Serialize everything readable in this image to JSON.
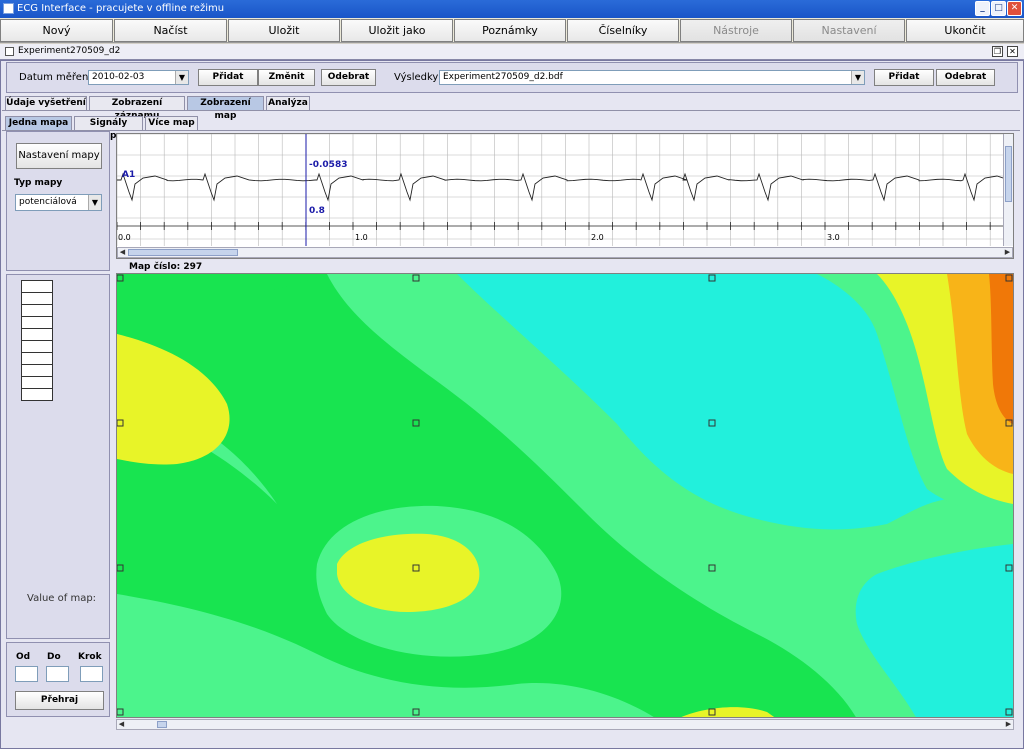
{
  "window": {
    "title": "ECG Interface - pracujete v offline režimu"
  },
  "toolbar": {
    "new": "Nový",
    "load": "Načíst",
    "save": "Uložit",
    "save_as": "Uložit jako",
    "notes": "Poznámky",
    "codebooks": "Číselníky",
    "tools": "Nástroje",
    "settings": "Nastavení",
    "quit": "Ukončit"
  },
  "frame": {
    "title": "Experiment270509_d2"
  },
  "datum": {
    "label": "Datum měření",
    "value": "2010-02-03",
    "add": "Přidat",
    "change": "Změnit",
    "remove": "Odebrat",
    "results_label": "Výsledky",
    "results_value": "Experiment270509_d2.bdf",
    "results_add": "Přidat",
    "results_remove": "Odebrat"
  },
  "tabs": [
    "Údaje vyšetření",
    "Zobrazení záznamu",
    "Zobrazení map",
    "Analýza"
  ],
  "subtabs": [
    "Jedna mapa",
    "Signály mapy",
    "Více map"
  ],
  "left": {
    "map_settings": "Nastavení mapy",
    "map_type_label": "Typ mapy",
    "map_type_value": "potenciálová",
    "value_of_map": "Value of map:",
    "from": "Od",
    "to": "Do",
    "step": "Krok",
    "play": "Přehraj"
  },
  "ecg": {
    "lead": "A1",
    "cursor_value": "-0.0583",
    "cursor_time": "0.8",
    "ticks": [
      "0.0",
      "1.0",
      "2.0",
      "3.0"
    ]
  },
  "map": {
    "label": "Map číslo: 297"
  },
  "colors": {
    "map_cyan": "#22f0dc",
    "map_lightgreen": "#4cf48c",
    "map_green": "#18e450",
    "map_yellow": "#e8f428",
    "map_orange": "#f8b418",
    "map_darkorange": "#f07808",
    "ecg_cursor": "#1a1aa8"
  }
}
